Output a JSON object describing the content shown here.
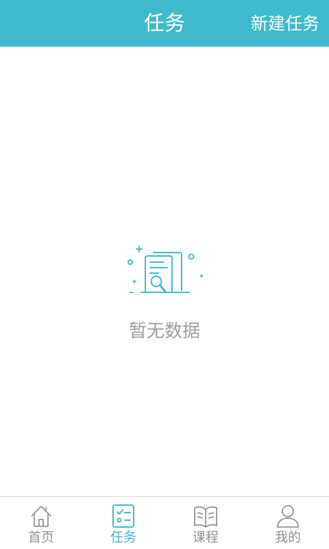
{
  "header": {
    "title": "任务",
    "action_label": "新建任务"
  },
  "empty_state": {
    "message": "暂无数据",
    "icon": "document-search-icon"
  },
  "tabbar": {
    "active": "tasks",
    "items": [
      {
        "key": "home",
        "label": "首页",
        "icon": "home-icon"
      },
      {
        "key": "tasks",
        "label": "任务",
        "icon": "task-checklist-icon"
      },
      {
        "key": "courses",
        "label": "课程",
        "icon": "book-icon"
      },
      {
        "key": "me",
        "label": "我的",
        "icon": "user-icon"
      }
    ]
  },
  "colors": {
    "accent": "#3ebacb",
    "inactive": "#8e9397",
    "empty_text": "#999ea3"
  }
}
